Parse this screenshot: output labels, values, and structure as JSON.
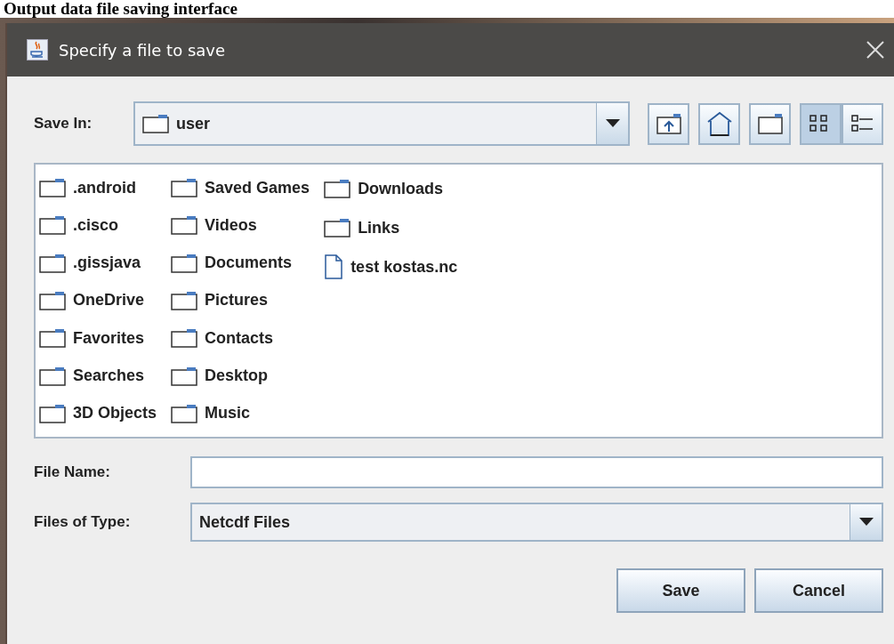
{
  "heading": "Output data file saving interface",
  "window": {
    "title": "Specify a file to save"
  },
  "save_in": {
    "label": "Save In:",
    "value": "user"
  },
  "toolbar": [
    {
      "kind": "up",
      "selected": false
    },
    {
      "kind": "home",
      "selected": false
    },
    {
      "kind": "newfolder",
      "selected": false
    },
    {
      "kind": "list",
      "selected": true
    },
    {
      "kind": "details",
      "selected": false
    }
  ],
  "files": [
    [
      {
        "name": ".android",
        "kind": "folder"
      },
      {
        "name": ".cisco",
        "kind": "folder"
      },
      {
        "name": ".gissjava",
        "kind": "folder"
      },
      {
        "name": "OneDrive",
        "kind": "folder"
      },
      {
        "name": "Favorites",
        "kind": "folder"
      },
      {
        "name": "Searches",
        "kind": "folder"
      },
      {
        "name": "3D Objects",
        "kind": "folder"
      }
    ],
    [
      {
        "name": "Saved Games",
        "kind": "folder"
      },
      {
        "name": "Videos",
        "kind": "folder"
      },
      {
        "name": "Documents",
        "kind": "folder"
      },
      {
        "name": "Pictures",
        "kind": "folder"
      },
      {
        "name": "Contacts",
        "kind": "folder"
      },
      {
        "name": "Desktop",
        "kind": "folder"
      },
      {
        "name": "Music",
        "kind": "folder"
      }
    ],
    [
      {
        "name": "Downloads",
        "kind": "folder"
      },
      {
        "name": "Links",
        "kind": "folder"
      },
      {
        "name": "test kostas.nc",
        "kind": "file"
      }
    ]
  ],
  "file_name": {
    "label": "File Name:"
  },
  "file_type": {
    "label": "Files of Type:",
    "value": "Netcdf Files"
  },
  "buttons": [
    "Save",
    "Cancel"
  ]
}
